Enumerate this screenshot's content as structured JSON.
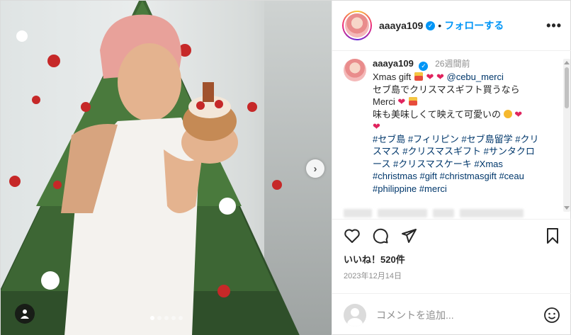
{
  "header": {
    "username": "aaaya109",
    "separator": "•",
    "follow_label": "フォローする",
    "more_label": "•••"
  },
  "caption": {
    "username": "aaaya109",
    "time": "26週間前",
    "line1_text": "Xmas gift",
    "mention": "@cebu_merci",
    "line2": "セブ島でクリスマスギフト買うなら",
    "line3": "Merci",
    "line4": "味も美味しくて映えて可愛いの",
    "hashtags": "#セブ島 #フィリピン #セブ島留学 #クリスマス #クリスマスギフト #サンタクロース #クリスマスケーキ #Xmas #christmas #gift #christmasgift #ceau #philippine #merci"
  },
  "post": {
    "likes": "いいね！520件",
    "date": "2023年12月14日"
  },
  "comment": {
    "placeholder": "コメントを追加..."
  },
  "carousel": {
    "dot_count": 5,
    "active_index": 0
  },
  "colors": {
    "accent": "#0095f6",
    "text": "#262626",
    "muted": "#8e8e8e",
    "link": "#00376b",
    "heart": "#e0245e"
  }
}
